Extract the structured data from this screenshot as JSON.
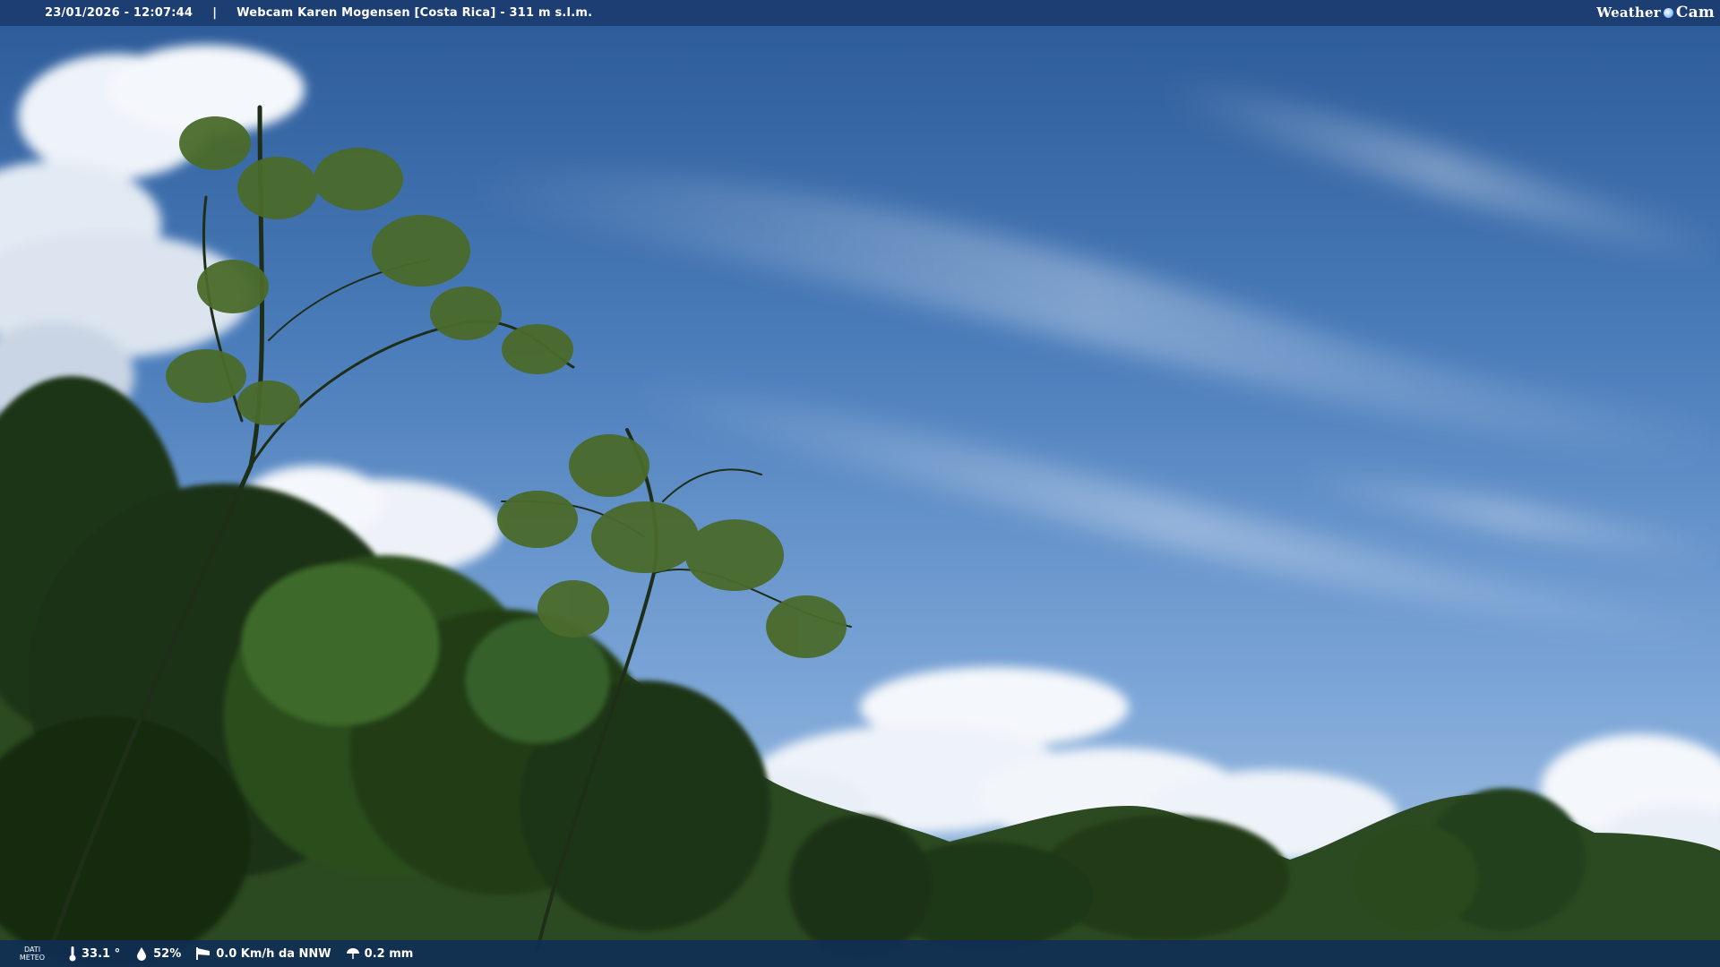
{
  "header": {
    "datetime": "23/01/2026 - 12:07:44",
    "separator": "|",
    "location": "Webcam Karen Mogensen [Costa Rica] - 311 m s.l.m."
  },
  "logo": {
    "word1": "Weather",
    "word2": "Cam"
  },
  "footer": {
    "dati_line1": "DATI",
    "dati_line2": "METEO",
    "temperature": "33.1 °",
    "humidity": "52%",
    "wind": "0.0 Km/h da NNW",
    "rain": "0.2 mm"
  },
  "icons": {
    "temperature": "thermometer-icon",
    "humidity": "humidity-drop-icon",
    "wind": "wind-sock-icon",
    "rain": "rain-icon"
  },
  "colors": {
    "sky_top": "#2f5f9e",
    "sky_horizon": "#9dbde0",
    "cloud": "#f4f7fb",
    "foliage_dark": "#142a10",
    "foliage_mid": "#2f5520",
    "bar_top": "#1c3c70",
    "bar_bottom": "#0f2d55"
  }
}
